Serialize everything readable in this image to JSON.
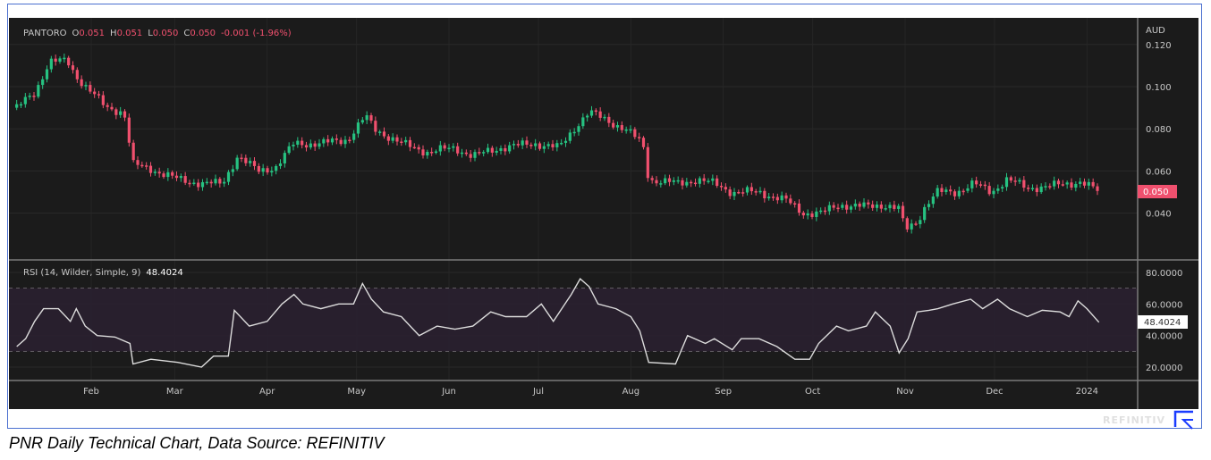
{
  "header": {
    "symbol": "PANTORO",
    "o_label": "O",
    "o": "0.051",
    "h_label": "H",
    "h": "0.051",
    "l_label": "L",
    "l": "0.050",
    "c_label": "C",
    "c": "0.050",
    "change": "-0.001 (-1.96%)"
  },
  "rsi_header": {
    "label": "RSI (14, Wilder, Simple, 9)",
    "value": "48.4024"
  },
  "currency": "AUD",
  "last_price": "0.050",
  "last_rsi": "48.4024",
  "brand": "REFINITIV",
  "caption": "PNR Daily Technical Chart, Data Source: REFINITIV",
  "colors": {
    "up": "#26c281",
    "down": "#f0506e",
    "bg": "#1b1b1b",
    "rsi_band": "#2a2030",
    "brand": "#1a3cff"
  },
  "chart_data": [
    {
      "type": "candlestick",
      "title": "PANTORO",
      "ylabel": "AUD",
      "ylim": [
        0.025,
        0.125
      ],
      "yticks": [
        "0.120",
        "0.100",
        "0.080",
        "0.060",
        "0.040"
      ],
      "xticks": [
        {
          "day": 32,
          "label": "Feb"
        },
        {
          "day": 60,
          "label": "Mar"
        },
        {
          "day": 91,
          "label": "Apr"
        },
        {
          "day": 121,
          "label": "May"
        },
        {
          "day": 152,
          "label": "Jun"
        },
        {
          "day": 182,
          "label": "Jul"
        },
        {
          "day": 213,
          "label": "Aug"
        },
        {
          "day": 244,
          "label": "Sep"
        },
        {
          "day": 274,
          "label": "Oct"
        },
        {
          "day": 305,
          "label": "Nov"
        },
        {
          "day": 335,
          "label": "Dec"
        },
        {
          "day": 366,
          "label": "2024"
        }
      ],
      "closes": [
        [
          7,
          0.09
        ],
        [
          13,
          0.097
        ],
        [
          18,
          0.112
        ],
        [
          24,
          0.112
        ],
        [
          27,
          0.105
        ],
        [
          31,
          0.099
        ],
        [
          37,
          0.09
        ],
        [
          43,
          0.088
        ],
        [
          46,
          0.063
        ],
        [
          52,
          0.061
        ],
        [
          61,
          0.056
        ],
        [
          70,
          0.054
        ],
        [
          76,
          0.054
        ],
        [
          81,
          0.067
        ],
        [
          88,
          0.06
        ],
        [
          94,
          0.062
        ],
        [
          100,
          0.073
        ],
        [
          109,
          0.073
        ],
        [
          118,
          0.075
        ],
        [
          124,
          0.086
        ],
        [
          127,
          0.08
        ],
        [
          136,
          0.073
        ],
        [
          145,
          0.069
        ],
        [
          154,
          0.071
        ],
        [
          160,
          0.067
        ],
        [
          169,
          0.071
        ],
        [
          181,
          0.073
        ],
        [
          189,
          0.071
        ],
        [
          195,
          0.082
        ],
        [
          199,
          0.088
        ],
        [
          205,
          0.084
        ],
        [
          211,
          0.08
        ],
        [
          217,
          0.073
        ],
        [
          219,
          0.056
        ],
        [
          229,
          0.054
        ],
        [
          235,
          0.056
        ],
        [
          241,
          0.054
        ],
        [
          247,
          0.05
        ],
        [
          256,
          0.05
        ],
        [
          265,
          0.046
        ],
        [
          271,
          0.04
        ],
        [
          277,
          0.04
        ],
        [
          283,
          0.044
        ],
        [
          292,
          0.043
        ],
        [
          298,
          0.044
        ],
        [
          303,
          0.042
        ],
        [
          305,
          0.032
        ],
        [
          309,
          0.036
        ],
        [
          312,
          0.044
        ],
        [
          316,
          0.05
        ],
        [
          322,
          0.05
        ],
        [
          328,
          0.054
        ],
        [
          334,
          0.05
        ],
        [
          339,
          0.056
        ],
        [
          346,
          0.052
        ],
        [
          355,
          0.053
        ],
        [
          364,
          0.055
        ],
        [
          370,
          0.05
        ]
      ]
    },
    {
      "type": "line",
      "title": "RSI (14, Wilder, Simple, 9)",
      "ylim": [
        12,
        88
      ],
      "yticks": [
        "80.0000",
        "60.0000",
        "40.0000",
        "20.0000"
      ],
      "band": [
        30,
        70
      ],
      "points": [
        [
          7,
          33
        ],
        [
          10,
          38
        ],
        [
          13,
          49
        ],
        [
          16,
          57
        ],
        [
          21,
          57
        ],
        [
          25,
          49
        ],
        [
          27,
          57
        ],
        [
          30,
          46
        ],
        [
          34,
          40
        ],
        [
          40,
          39
        ],
        [
          45,
          35
        ],
        [
          46,
          22
        ],
        [
          52,
          25
        ],
        [
          61,
          23
        ],
        [
          69,
          20
        ],
        [
          73,
          27
        ],
        [
          78,
          27
        ],
        [
          80,
          56
        ],
        [
          85,
          46
        ],
        [
          91,
          49
        ],
        [
          96,
          60
        ],
        [
          100,
          66
        ],
        [
          103,
          60
        ],
        [
          109,
          57
        ],
        [
          115,
          60
        ],
        [
          120,
          60
        ],
        [
          123,
          73
        ],
        [
          126,
          63
        ],
        [
          130,
          55
        ],
        [
          136,
          52
        ],
        [
          142,
          40
        ],
        [
          148,
          46
        ],
        [
          154,
          44
        ],
        [
          160,
          46
        ],
        [
          166,
          55
        ],
        [
          171,
          52
        ],
        [
          178,
          52
        ],
        [
          183,
          60
        ],
        [
          187,
          49
        ],
        [
          193,
          66
        ],
        [
          196,
          76
        ],
        [
          199,
          71
        ],
        [
          202,
          60
        ],
        [
          208,
          57
        ],
        [
          213,
          52
        ],
        [
          216,
          43
        ],
        [
          219,
          23
        ],
        [
          228,
          22
        ],
        [
          232,
          40
        ],
        [
          238,
          35
        ],
        [
          241,
          38
        ],
        [
          247,
          31
        ],
        [
          250,
          38
        ],
        [
          256,
          38
        ],
        [
          262,
          33
        ],
        [
          268,
          25
        ],
        [
          273,
          25
        ],
        [
          276,
          35
        ],
        [
          282,
          46
        ],
        [
          286,
          43
        ],
        [
          292,
          46
        ],
        [
          295,
          55
        ],
        [
          300,
          46
        ],
        [
          303,
          29
        ],
        [
          306,
          38
        ],
        [
          309,
          55
        ],
        [
          313,
          56
        ],
        [
          316,
          57
        ],
        [
          321,
          60
        ],
        [
          327,
          63
        ],
        [
          331,
          57
        ],
        [
          336,
          63
        ],
        [
          340,
          57
        ],
        [
          346,
          52
        ],
        [
          351,
          56
        ],
        [
          357,
          55
        ],
        [
          360,
          52
        ],
        [
          363,
          62
        ],
        [
          366,
          57
        ],
        [
          370,
          48.4
        ]
      ]
    }
  ]
}
